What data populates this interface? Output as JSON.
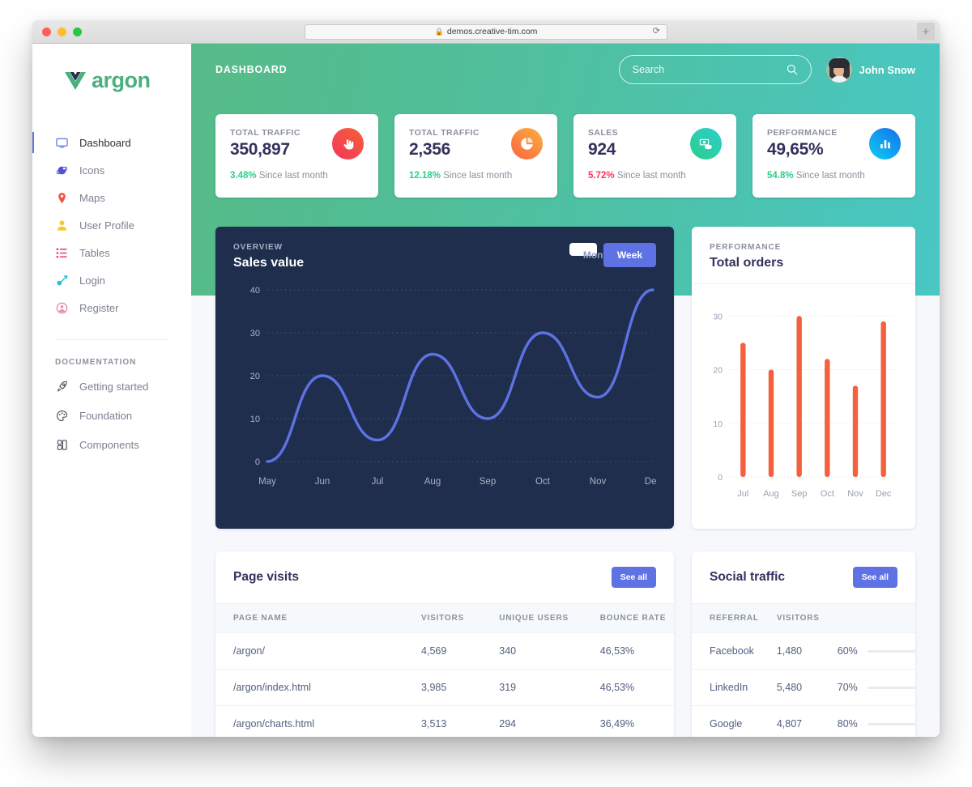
{
  "browser": {
    "url": "demos.creative-tim.com",
    "lock_icon": "lock-icon",
    "reload_icon": "reload-icon",
    "newtab_label": "+"
  },
  "sidebar": {
    "brand": "argon",
    "brand_logo": "vue-logo-icon",
    "items": [
      {
        "label": "Dashboard",
        "icon": "monitor-icon",
        "color": "#5e72e4",
        "active": true
      },
      {
        "label": "Icons",
        "icon": "atom-icon",
        "color": "#5152d6",
        "active": false
      },
      {
        "label": "Maps",
        "icon": "map-pin-icon",
        "color": "#f5533d",
        "active": false
      },
      {
        "label": "User Profile",
        "icon": "user-icon",
        "color": "#fbc531",
        "active": false
      },
      {
        "label": "Tables",
        "icon": "list-icon",
        "color": "#e8376b",
        "active": false
      },
      {
        "label": "Login",
        "icon": "key-icon",
        "color": "#2bc0d8",
        "active": false
      },
      {
        "label": "Register",
        "icon": "user-circle-icon",
        "color": "#e98aa0",
        "active": false
      }
    ],
    "section_title": "DOCUMENTATION",
    "doc_items": [
      {
        "label": "Getting started",
        "icon": "rocket-icon",
        "color": "#4a4f5c"
      },
      {
        "label": "Foundation",
        "icon": "palette-icon",
        "color": "#4a4f5c"
      },
      {
        "label": "Components",
        "icon": "components-icon",
        "color": "#4a4f5c"
      }
    ]
  },
  "topbar": {
    "title": "DASHBOARD",
    "search_placeholder": "Search",
    "search_value": "",
    "search_icon": "search-icon",
    "user_name": "John Snow",
    "avatar": "user-avatar"
  },
  "stats": [
    {
      "label": "TOTAL TRAFFIC",
      "value": "350,897",
      "pct": "3.48%",
      "pct_dir": "up",
      "since": "Since last month",
      "icon": "hand-pointer-icon",
      "icon_style": "ic-red"
    },
    {
      "label": "TOTAL TRAFFIC",
      "value": "2,356",
      "pct": "12.18%",
      "pct_dir": "up",
      "since": "Since last month",
      "icon": "pie-chart-icon",
      "icon_style": "ic-orange"
    },
    {
      "label": "SALES",
      "value": "924",
      "pct": "5.72%",
      "pct_dir": "down",
      "since": "Since last month",
      "icon": "money-icon",
      "icon_style": "ic-green"
    },
    {
      "label": "PERFORMANCE",
      "value": "49,65%",
      "pct": "54.8%",
      "pct_dir": "up",
      "since": "Since last month",
      "icon": "bar-chart-icon",
      "icon_style": "ic-blue"
    }
  ],
  "sales_chart": {
    "eyebrow": "OVERVIEW",
    "title": "Sales value",
    "buttons": {
      "month": "Month",
      "week": "Week"
    },
    "active_button": "Week"
  },
  "orders_chart": {
    "eyebrow": "PERFORMANCE",
    "title": "Total orders"
  },
  "page_visits": {
    "title": "Page visits",
    "see_all": "See all",
    "columns": [
      "PAGE NAME",
      "VISITORS",
      "UNIQUE USERS",
      "BOUNCE RATE"
    ],
    "rows": [
      [
        "/argon/",
        "4,569",
        "340",
        "46,53%"
      ],
      [
        "/argon/index.html",
        "3,985",
        "319",
        "46,53%"
      ],
      [
        "/argon/charts.html",
        "3,513",
        "294",
        "36,49%"
      ]
    ]
  },
  "social_traffic": {
    "title": "Social traffic",
    "see_all": "See all",
    "columns": [
      "REFERRAL",
      "VISITORS",
      ""
    ],
    "rows": [
      {
        "referral": "Facebook",
        "visitors": "1,480",
        "pct": "60%",
        "value": 60,
        "color": "#f5365c"
      },
      {
        "referral": "LinkedIn",
        "visitors": "5,480",
        "pct": "70%",
        "value": 70,
        "color": "#2dce89"
      },
      {
        "referral": "Google",
        "visitors": "4,807",
        "pct": "80%",
        "value": 80,
        "color": "#5e72e4"
      }
    ]
  },
  "chart_data": [
    {
      "type": "line",
      "title": "Sales value",
      "subtitle": "OVERVIEW",
      "x": [
        "May",
        "Jun",
        "Jul",
        "Aug",
        "Sep",
        "Oct",
        "Nov",
        "Dec"
      ],
      "values": [
        0,
        20,
        5,
        25,
        10,
        30,
        15,
        40
      ],
      "ylim": [
        0,
        40
      ],
      "yticks": [
        0,
        10,
        20,
        30,
        40
      ],
      "xlabel": "",
      "ylabel": "",
      "grid": true,
      "line_color": "#5e72e4",
      "background": "#1f2e4d",
      "legend": "none"
    },
    {
      "type": "bar",
      "title": "Total orders",
      "subtitle": "PERFORMANCE",
      "categories": [
        "Jul",
        "Aug",
        "Sep",
        "Oct",
        "Nov",
        "Dec"
      ],
      "values": [
        25,
        20,
        30,
        22,
        17,
        29
      ],
      "ylim": [
        0,
        32
      ],
      "yticks": [
        0,
        10,
        20,
        30
      ],
      "xlabel": "",
      "ylabel": "",
      "grid": true,
      "bar_color": "#f4603e",
      "background": "#ffffff",
      "legend": "none"
    }
  ]
}
